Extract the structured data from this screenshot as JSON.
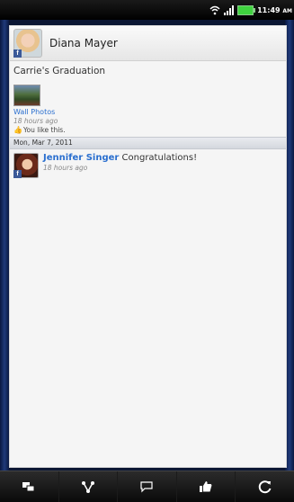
{
  "status_bar": {
    "time": "11:49",
    "ampm": "AM"
  },
  "profile": {
    "name": "Diana Mayer",
    "badge": "f"
  },
  "post": {
    "title": "Carrie's Graduation",
    "album_link": "Wall Photos",
    "time": "18 hours ago",
    "like_text": "You like this."
  },
  "date_divider": "Mon, Mar 7, 2011",
  "comments": [
    {
      "author": "Jennifer Singer",
      "text": "Congratulations!",
      "time": "18 hours ago",
      "badge": "f"
    }
  ],
  "bottom_bar": {
    "icons": [
      "chat-icon",
      "share-icon",
      "comment-icon",
      "like-icon",
      "refresh-icon"
    ]
  },
  "colors": {
    "link": "#2a6fcf",
    "facebook": "#3b5998"
  }
}
